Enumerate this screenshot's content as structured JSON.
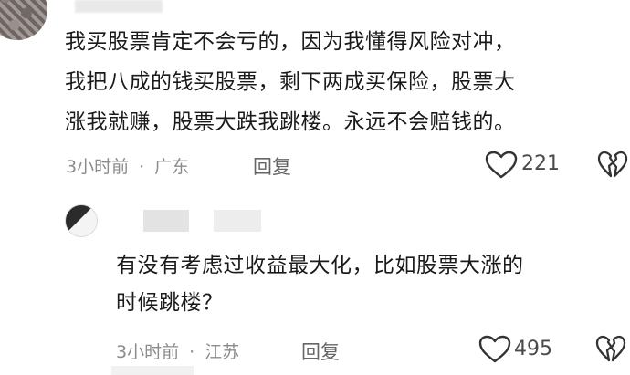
{
  "comment": {
    "lines": [
      "我买股票肯定不会亏的，因为我懂得风险对冲，",
      "我把八成的钱买股票，剩下两成买保险，股票大",
      "涨我就赚，股票大跌我跳楼。永远不会赔钱的。"
    ],
    "time": "3小时前",
    "location": "广东",
    "reply_label": "回复",
    "likes": "221"
  },
  "reply": {
    "lines": [
      "有没有考虑过收益最大化，比如股票大涨的",
      "时候跳楼？"
    ],
    "time": "3小时前",
    "location": "江苏",
    "reply_label": "回复",
    "likes": "495"
  },
  "icons": {
    "like": "heart-icon",
    "dislike": "broken-heart-icon"
  }
}
